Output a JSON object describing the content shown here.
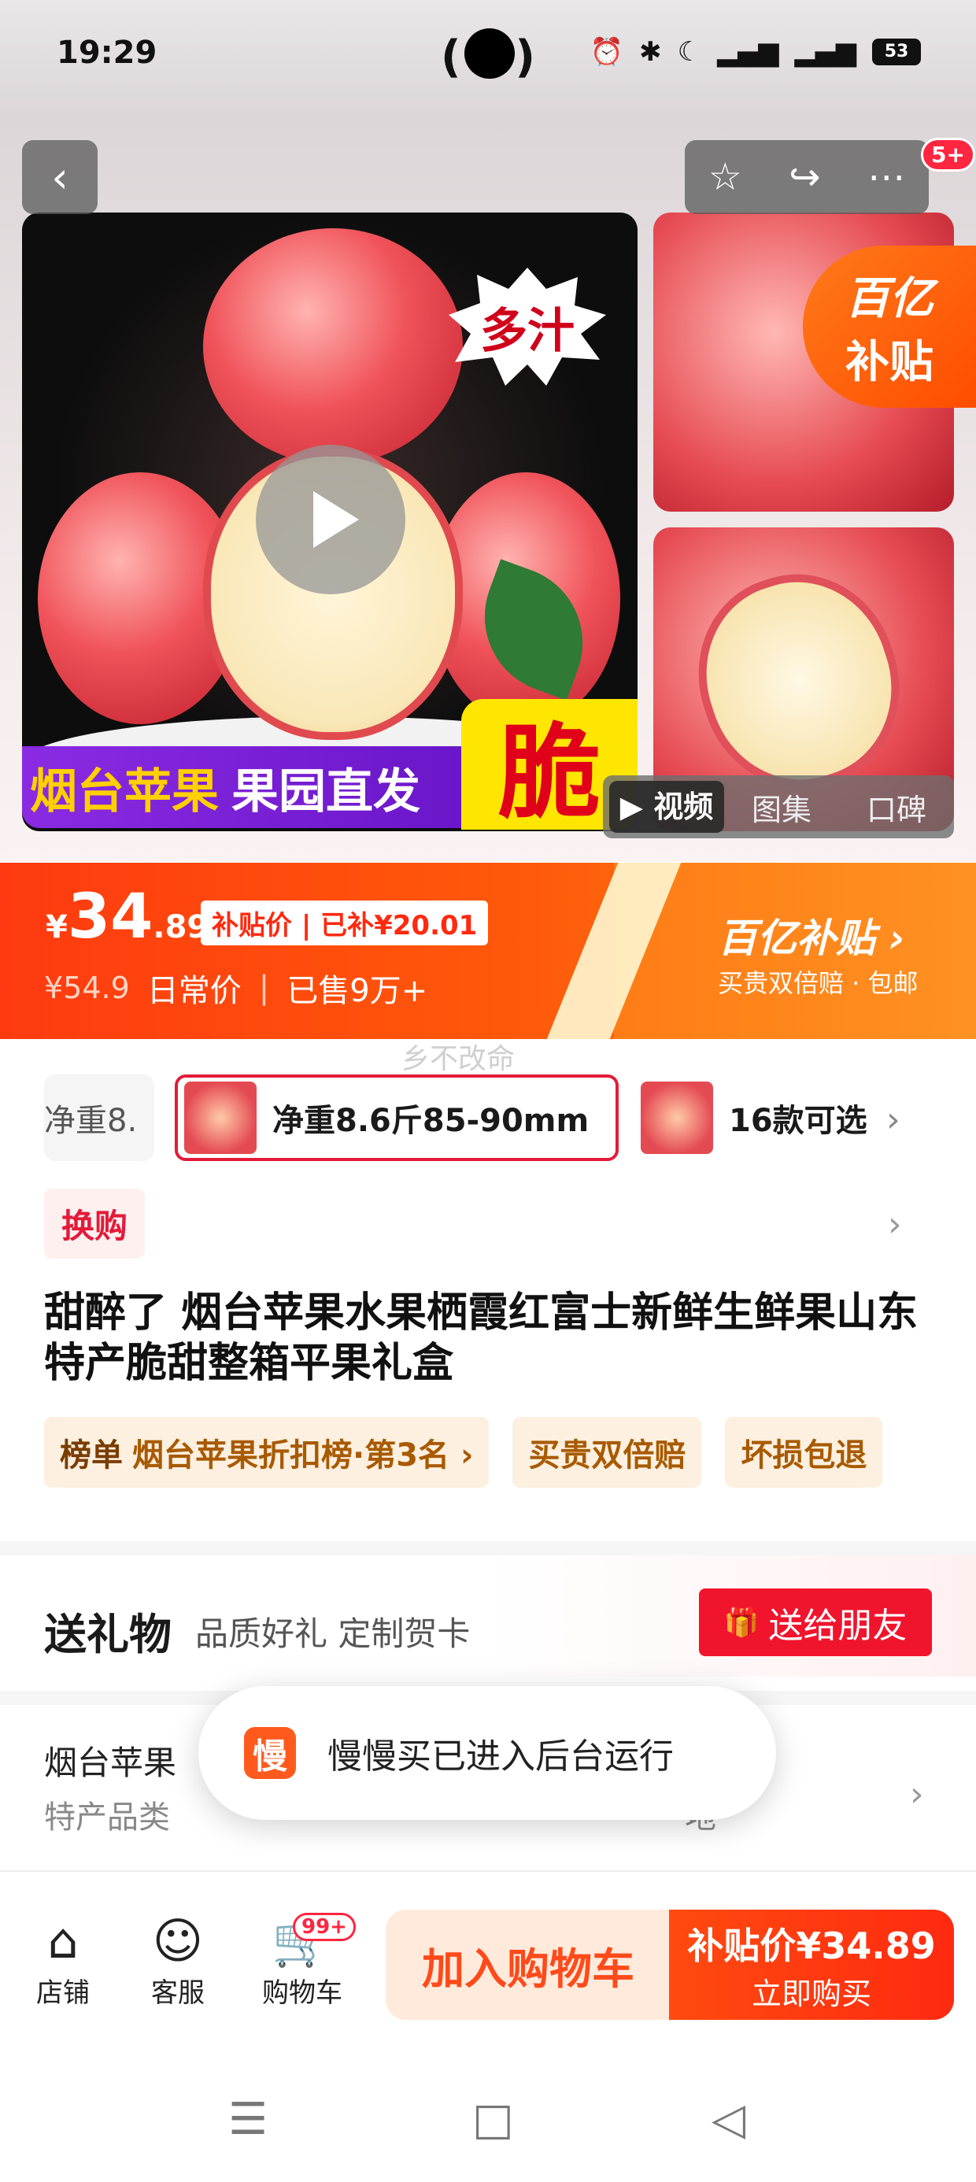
{
  "status_bar": {
    "time": "19:29",
    "battery": "53",
    "icons": [
      "alarm-icon",
      "bluetooth-icon",
      "moon-icon",
      "5g-signal-icon",
      "5g-signal-icon"
    ]
  },
  "header": {
    "back_icon": "chevron-left-icon",
    "actions": [
      "star-icon",
      "share-icon",
      "more-icon"
    ],
    "badge": "5+"
  },
  "gallery": {
    "main_tag": "多汁",
    "banner_left_1": "烟台苹果",
    "banner_left_2": "果园直发",
    "banner_right": "脆",
    "subsidy_corner_1": "百亿",
    "subsidy_corner_2": "补贴",
    "tabs": [
      "▶ 视频",
      "图集",
      "口碑"
    ]
  },
  "price": {
    "currency": "¥",
    "integer": "34",
    "decimal": ".89",
    "tag": "补贴价 | 已补¥20.01",
    "original": "¥54.9",
    "original_label": "日常价",
    "sold": "已售9万+",
    "subsidy_logo": "百亿补贴 ›",
    "subsidy_note": "买贵双倍赔 · 包邮"
  },
  "watermark": "乡不改命",
  "variants": {
    "items": [
      "净重8.",
      "净重8.6斤85-90mm",
      "16款可选"
    ]
  },
  "swap_badge": "换购",
  "product_title": "甜醉了 烟台苹果水果栖霞红富士新鲜生鲜果山东特产脆甜整箱平果礼盒",
  "chips": {
    "rank_label": "榜单",
    "rank_text": "烟台苹果折扣榜·第3名 ›",
    "chip2": "买贵双倍赔",
    "chip3": "坏损包退"
  },
  "gift": {
    "title": "送礼物",
    "subtitle": "品质好礼 定制贺卡",
    "button": "送给朋友"
  },
  "params": {
    "value": "烟台苹果",
    "label": "特产品类",
    "label_right": "地"
  },
  "toast": {
    "icon_char": "慢",
    "text": "慢慢买已进入后台运行"
  },
  "bottom_bar": {
    "shop": "店铺",
    "service": "客服",
    "cart": "购物车",
    "cart_badge": "99+",
    "add_to_cart": "加入购物车",
    "buy_price": "补贴价¥34.89",
    "buy_label": "立即购买"
  },
  "colors": {
    "accent": "#ff4a10",
    "brand_red": "#e31b3a"
  }
}
